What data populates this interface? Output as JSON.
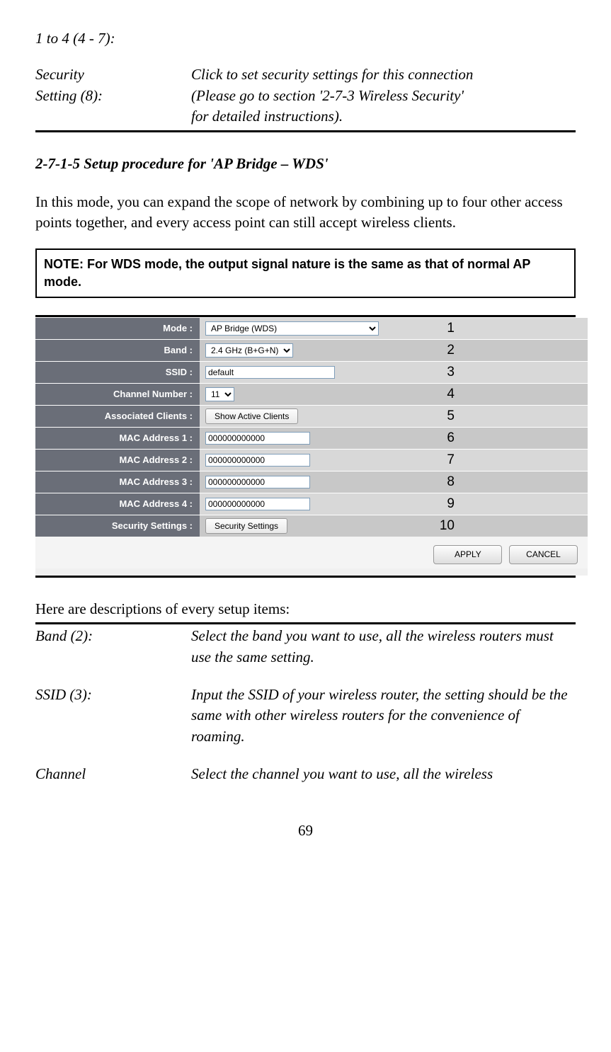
{
  "top": {
    "item1_label": "1 to 4 (4 - 7):",
    "security_label": "Security",
    "setting_label": "Setting (8):",
    "security_desc1": "Click to set security settings for this connection",
    "security_desc2": "(Please go to section '2-7-3 Wireless Security'",
    "security_desc3": "for detailed instructions)."
  },
  "section_heading": "2-7-1-5 Setup procedure for 'AP Bridge – WDS'",
  "intro_para": "In this mode, you can expand the scope of network by combining up to four other access points together, and every access point can still accept wireless clients.",
  "note_text": "NOTE: For WDS mode, the output signal nature is the same as that of normal AP mode.",
  "form": {
    "mode_label": "Mode :",
    "mode_value": "AP Bridge (WDS)",
    "band_label": "Band :",
    "band_value": "2.4 GHz (B+G+N)",
    "ssid_label": "SSID :",
    "ssid_value": "default",
    "channel_label": "Channel Number :",
    "channel_value": "11",
    "assoc_label": "Associated Clients :",
    "assoc_button": "Show Active Clients",
    "mac1_label": "MAC Address 1 :",
    "mac2_label": "MAC Address 2 :",
    "mac3_label": "MAC Address 3 :",
    "mac4_label": "MAC Address 4 :",
    "mac_value": "000000000000",
    "security_label": "Security Settings :",
    "security_button": "Security Settings",
    "apply": "APPLY",
    "cancel": "CANCEL"
  },
  "callouts": {
    "c1": "1",
    "c2": "2",
    "c3": "3",
    "c4": "4",
    "c5": "5",
    "c6": "6",
    "c7": "7",
    "c8": "8",
    "c9": "9",
    "c10": "10"
  },
  "descriptions": {
    "intro": "Here are descriptions of every setup items:",
    "band_label": "Band (2):",
    "band_desc": "Select the band you want to use, all the wireless routers must use the same setting.",
    "ssid_label": "SSID (3):",
    "ssid_desc": "Input the SSID of your wireless router, the setting should be the same with other wireless routers for the convenience of roaming.",
    "channel_label": "Channel",
    "channel_desc": "Select the channel you want to use, all the wireless"
  },
  "page_number": "69"
}
